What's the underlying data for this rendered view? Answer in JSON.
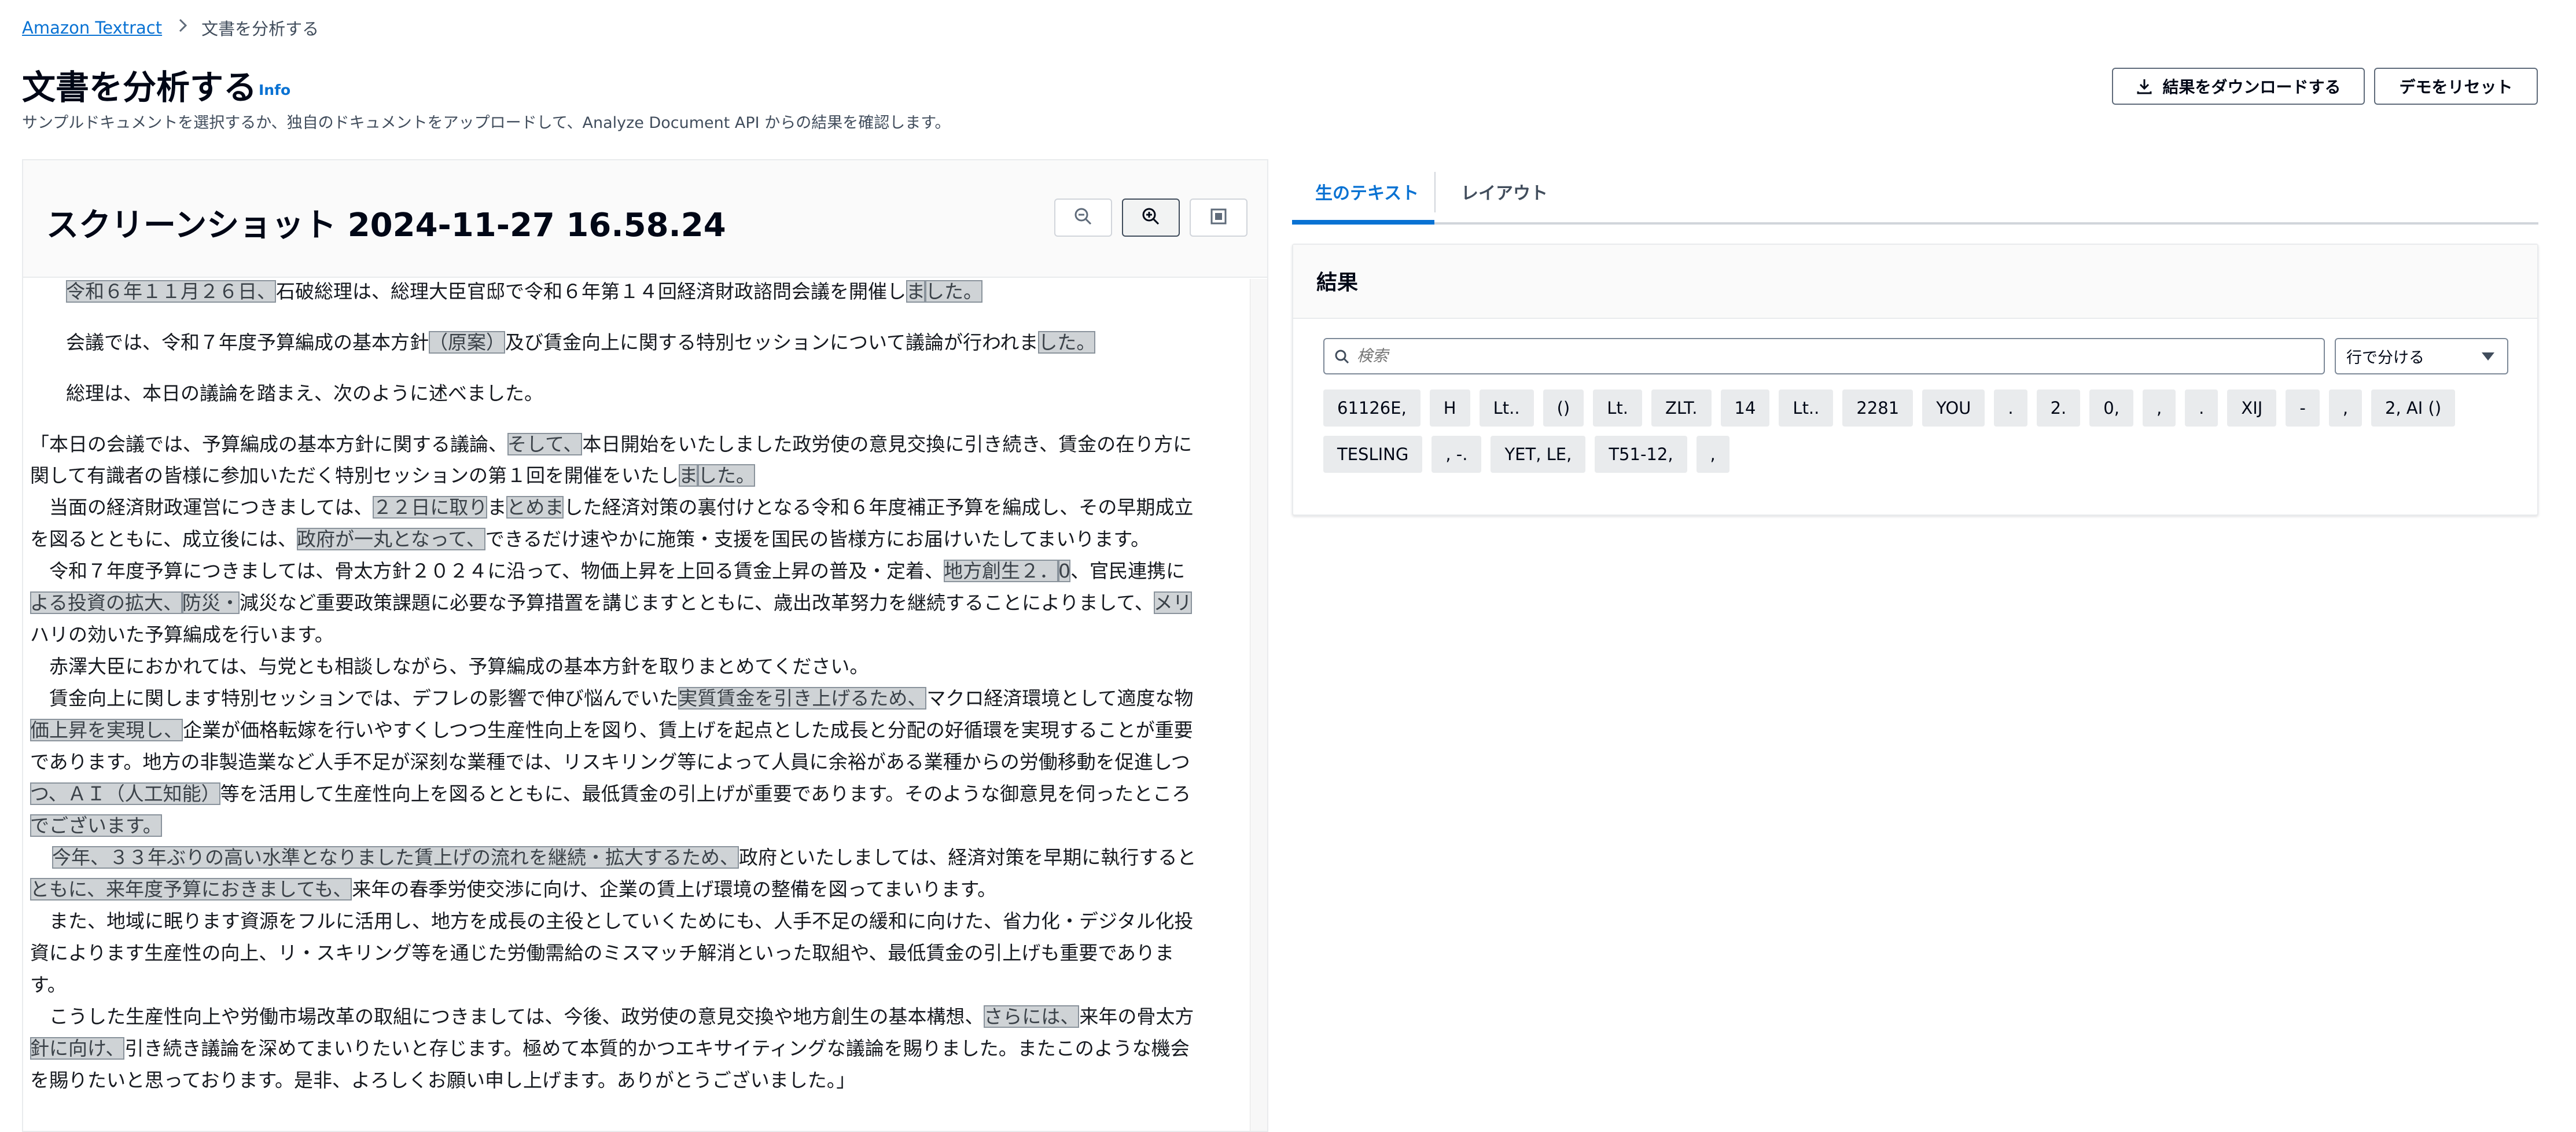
{
  "breadcrumb": {
    "root": "Amazon Textract",
    "current": "文書を分析する"
  },
  "header": {
    "title": "文書を分析する",
    "info": "Info",
    "description": "サンプルドキュメントを選択するか、独自のドキュメントをアップロードして、Analyze Document API からの結果を確認します。",
    "download_label": "結果をダウンロードする",
    "reset_label": "デモをリセット"
  },
  "document": {
    "title": "スクリーンショット 2024-11-27 16.58.24",
    "lines": [
      [
        [
          "令和６年１１月２６日、",
          true
        ],
        [
          "石破総理は、総理大臣官邸で令和６年第１４回経済財政諮問会議を開催し",
          false
        ],
        [
          "ま",
          true
        ],
        [
          "した。",
          true
        ]
      ],
      [
        [
          "会議では、令和７年度予算編成の基本方針",
          false
        ],
        [
          "（原案）",
          true
        ],
        [
          "及び賃金向上に関する特別セッションについて議論が行われま",
          false
        ],
        [
          "した。",
          true
        ]
      ],
      [
        [
          "総理は、本日の議論を踏まえ、次のように述べました。",
          false
        ]
      ],
      [
        [
          "「本日の会議では、予算編成の基本方針に関する議論、",
          false
        ],
        [
          "そして、",
          true
        ],
        [
          "本日開始をいたしました政労使の意見交換に引き続き、賃金の在り方に",
          false
        ]
      ],
      [
        [
          "関して有識者の皆様に参加いただく特別セッションの第１回を開催をいたし",
          false
        ],
        [
          "ま",
          true
        ],
        [
          "した。",
          true
        ]
      ],
      [
        [
          "　当面の経済財政運営につきましては、",
          false
        ],
        [
          "２２日に取り",
          true
        ],
        [
          "ま",
          false
        ],
        [
          "とめま",
          true
        ],
        [
          "した経済対策の裏付けとなる令和６年度補正予算を編成し、その早期成立",
          false
        ]
      ],
      [
        [
          "を図るとともに、成立後には、",
          false
        ],
        [
          "政府が一丸となって、",
          true
        ],
        [
          "できるだけ速やかに施策・支援を国民の皆様方にお届けいたしてまいります。",
          false
        ]
      ],
      [
        [
          "　令和７年度予算につきましては、骨太方針２０２４に沿って、物価上昇を上回る賃金上昇の普及・定着、",
          false
        ],
        [
          "地方創生２．",
          true
        ],
        [
          "0",
          true
        ],
        [
          "、",
          false
        ],
        [
          "官民連携に",
          false
        ]
      ],
      [
        [
          "よる投資の拡大、",
          true
        ],
        [
          "防災・",
          true
        ],
        [
          "減災など重要政策課題に必要な予算措置を講じますとともに、歳出改革努力を継続することによりまして、",
          false
        ],
        [
          "メリ",
          true
        ]
      ],
      [
        [
          "ハリの効いた予算編成を行います。",
          false
        ]
      ],
      [
        [
          "　赤澤大臣におかれては、与党とも相談しながら、予算編成の基本方針を取りまとめてください。",
          false
        ]
      ],
      [
        [
          "　賃金向上に関します特別セッションでは、デフレの影響で伸び悩んでいた",
          false
        ],
        [
          "実質賃金を引き上げるため、",
          true
        ],
        [
          "マクロ経済環境として適度な物",
          false
        ]
      ],
      [
        [
          "価上昇を実現し、",
          true
        ],
        [
          "企業が価格転嫁を行いやすくしつつ生産性向上を図り、賃上げを起点とした成長と分配の好循環を実現することが重要",
          false
        ]
      ],
      [
        [
          "であります。地方の非製造業など人手不足が深刻な業種では、リスキリング等によって人員に余裕がある業種からの労働移動を促進しつ",
          false
        ]
      ],
      [
        [
          "つ、ＡＩ（人工知能）",
          true
        ],
        [
          "等を活用して生産性向上を図るとともに、最低賃金の引上げが重要であります。そのような御意見を伺ったところ",
          false
        ]
      ],
      [
        [
          "でございます。",
          true
        ]
      ],
      [
        [
          "今年、３３年ぶりの高い水準となりました賃上げの流れを継続・拡大するため、",
          true
        ],
        [
          "政府といたしましては、経済対策を早期に執行すると",
          false
        ]
      ],
      [
        [
          "ともに、来年度予算におきましても、",
          true
        ],
        [
          "来年の春季労使交渉に向け、企業の賃上げ環境の整備を図ってまいります。",
          false
        ]
      ],
      [
        [
          "　また、地域に眠ります資源をフルに活用し、地方を成長の主役としていくためにも、人手不足の緩和に向けた、省力化・デジタル化投",
          false
        ]
      ],
      [
        [
          "資によります生産性の向上、リ・スキリング等を通じた労働需給のミスマッチ解消といった取組や、最低賃金の引上げも重要でありま",
          false
        ]
      ],
      [
        [
          "す。",
          false
        ]
      ],
      [
        [
          "　こうした生産性向上や労働市場改革の取組につきましては、今後、政労使の意見交換や地方創生の基本構想、",
          false
        ],
        [
          "さらには、",
          true
        ],
        [
          "来年の骨太方",
          false
        ]
      ],
      [
        [
          "針に向け、",
          true
        ],
        [
          "引き続き議論を深めてまいりたいと存じます。極めて本質的かつエキサイティングな議論を賜りました。またこのような機会",
          false
        ]
      ],
      [
        [
          "を賜りたいと思っております。是非、よろしくお願い申し上げます。ありがとうございました。」",
          false
        ]
      ]
    ]
  },
  "tabs": {
    "raw_text": "生のテキスト",
    "layout": "レイアウト"
  },
  "results": {
    "title": "結果",
    "search_placeholder": "検索",
    "select_value": "行で分ける",
    "tokens": [
      "61126E,",
      "H",
      "Lt..",
      "()",
      "Lt.",
      "ZLT.",
      "14",
      "Lt..",
      "2281",
      "YOU",
      ".",
      "2.",
      "0,",
      ",",
      ".",
      "XIJ",
      "-",
      ",",
      "2, AI ()",
      "TESLING",
      ", -.",
      "YET, LE,",
      "T51-12,",
      ","
    ]
  },
  "icons": {
    "breadcrumb_sep": "chevron-right-icon",
    "download": "download-icon",
    "zoom_out": "zoom-out-icon",
    "zoom_in": "zoom-in-icon",
    "fit": "fit-to-screen-icon",
    "search": "search-icon",
    "caret": "caret-down-icon"
  },
  "colors": {
    "link": "#0972d3",
    "highlight": "#cfd3d6"
  }
}
